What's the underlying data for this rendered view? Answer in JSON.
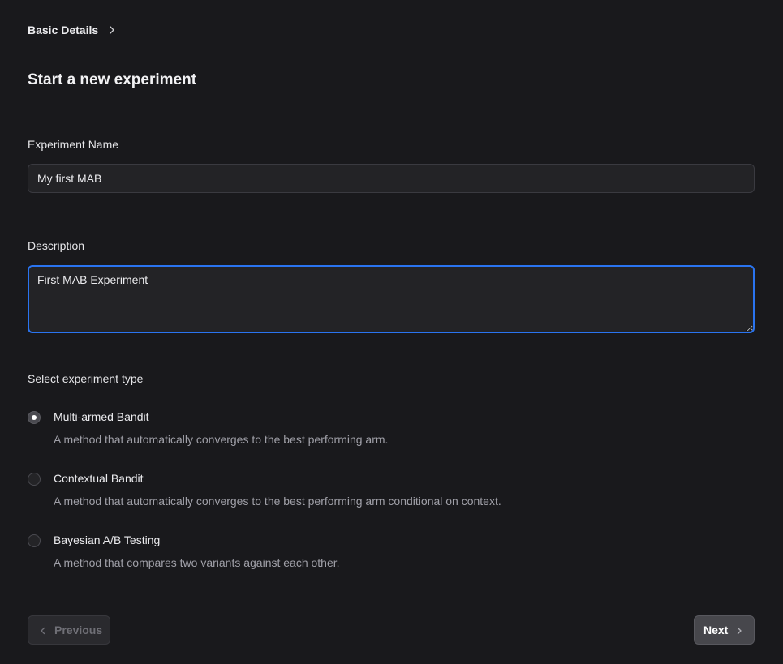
{
  "breadcrumb": {
    "current": "Basic Details"
  },
  "page": {
    "title": "Start a new experiment"
  },
  "form": {
    "name_label": "Experiment Name",
    "name_value": "My first MAB",
    "description_label": "Description",
    "description_value": "First MAB Experiment",
    "type_label": "Select experiment type",
    "options": [
      {
        "title": "Multi-armed Bandit",
        "description": "A method that automatically converges to the best performing arm.",
        "selected": true
      },
      {
        "title": "Contextual Bandit",
        "description": "A method that automatically converges to the best performing arm conditional on context.",
        "selected": false
      },
      {
        "title": "Bayesian A/B Testing",
        "description": "A method that compares two variants against each other.",
        "selected": false
      }
    ]
  },
  "footer": {
    "previous_label": "Previous",
    "next_label": "Next"
  },
  "colors": {
    "background": "#19191c",
    "focus_ring": "#2a74f0"
  },
  "icons": {
    "breadcrumb_separator": "chevron-right-icon",
    "previous": "chevron-left-icon",
    "next": "chevron-right-icon"
  }
}
